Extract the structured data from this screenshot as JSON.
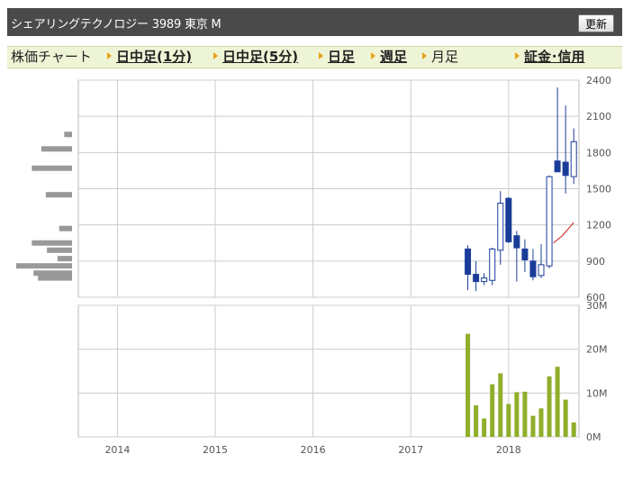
{
  "header": {
    "title": "シェアリングテクノロジー 3989 東京 M",
    "refresh_label": "更新"
  },
  "tabs": [
    {
      "label": "株価チャート",
      "link": false,
      "arrow": false
    },
    {
      "label": "日中足(1分)",
      "link": true,
      "arrow": true
    },
    {
      "label": "日中足(5分)",
      "link": true,
      "arrow": true
    },
    {
      "label": "日足",
      "link": true,
      "arrow": true
    },
    {
      "label": "週足",
      "link": true,
      "arrow": true
    },
    {
      "label": "月足",
      "link": false,
      "arrow": true
    },
    {
      "label": "証金･信用",
      "link": true,
      "arrow": true
    }
  ],
  "colors": {
    "up_candle": "#ffffff",
    "down_candle": "#1a3c99",
    "volume_bar": "#8fae2a",
    "moving_average": "#d01919",
    "volume_profile": "#999999",
    "grid": "#cccccc",
    "header_bg": "#4a4a4a",
    "tab_bg": "#eef5d6",
    "tab_arrow": "#e8a11a"
  },
  "chart_data": [
    {
      "type": "candlestick",
      "name": "price",
      "y_ticks": [
        "2400",
        "2100",
        "1800",
        "1500",
        "1200",
        "900",
        "600"
      ],
      "ylim": [
        600,
        2400
      ],
      "x_ticks": [
        "2014",
        "2015",
        "2016",
        "2017",
        "2018"
      ],
      "x_tick_positions": [
        2014,
        2015,
        2016,
        2017,
        2018
      ],
      "xlim": [
        2013.6,
        2018.72
      ],
      "grid": true,
      "candles": [
        {
          "t": 2017.5833,
          "open": 1000,
          "high": 1030,
          "low": 660,
          "close": 790
        },
        {
          "t": 2017.6667,
          "open": 790,
          "high": 900,
          "low": 650,
          "close": 730
        },
        {
          "t": 2017.75,
          "open": 730,
          "high": 800,
          "low": 700,
          "close": 760
        },
        {
          "t": 2017.8333,
          "open": 740,
          "high": 1010,
          "low": 700,
          "close": 1000
        },
        {
          "t": 2017.9167,
          "open": 990,
          "high": 1480,
          "low": 870,
          "close": 1380
        },
        {
          "t": 2018.0,
          "open": 1420,
          "high": 1430,
          "low": 1050,
          "close": 1060
        },
        {
          "t": 2018.0833,
          "open": 1110,
          "high": 1150,
          "low": 730,
          "close": 1010
        },
        {
          "t": 2018.1667,
          "open": 1000,
          "high": 1080,
          "low": 810,
          "close": 910
        },
        {
          "t": 2018.25,
          "open": 900,
          "high": 1000,
          "low": 740,
          "close": 770
        },
        {
          "t": 2018.3333,
          "open": 780,
          "high": 1040,
          "low": 760,
          "close": 870
        },
        {
          "t": 2018.4167,
          "open": 860,
          "high": 1610,
          "low": 840,
          "close": 1600
        },
        {
          "t": 2018.5,
          "open": 1730,
          "high": 2340,
          "low": 1640,
          "close": 1640
        },
        {
          "t": 2018.5833,
          "open": 1720,
          "high": 2190,
          "low": 1460,
          "close": 1610
        },
        {
          "t": 2018.6667,
          "open": 1600,
          "high": 2000,
          "low": 1540,
          "close": 1890
        }
      ],
      "moving_average": [
        {
          "t": 2018.4583,
          "v": 1050
        },
        {
          "t": 2018.55,
          "v": 1110
        },
        {
          "t": 2018.6667,
          "v": 1220
        }
      ],
      "volume_profile": [
        {
          "price": 1950,
          "weight": 0.14
        },
        {
          "price": 1830,
          "weight": 0.55
        },
        {
          "price": 1670,
          "weight": 0.72
        },
        {
          "price": 1450,
          "weight": 0.47
        },
        {
          "price": 1170,
          "weight": 0.23
        },
        {
          "price": 1050,
          "weight": 0.72
        },
        {
          "price": 990,
          "weight": 0.45
        },
        {
          "price": 920,
          "weight": 0.26
        },
        {
          "price": 860,
          "weight": 1.0
        },
        {
          "price": 800,
          "weight": 0.69
        },
        {
          "price": 760,
          "weight": 0.61
        }
      ]
    },
    {
      "type": "bar",
      "name": "volume",
      "y_ticks": [
        "30M",
        "20M",
        "10M",
        "0M"
      ],
      "ylim": [
        0,
        30
      ],
      "unit": "M",
      "grid": true,
      "bars": [
        {
          "t": 2017.5833,
          "v": 23.5
        },
        {
          "t": 2017.6667,
          "v": 7.2
        },
        {
          "t": 2017.75,
          "v": 4.2
        },
        {
          "t": 2017.8333,
          "v": 12.0
        },
        {
          "t": 2017.9167,
          "v": 14.5
        },
        {
          "t": 2018.0,
          "v": 7.5
        },
        {
          "t": 2018.0833,
          "v": 10.2
        },
        {
          "t": 2018.1667,
          "v": 10.3
        },
        {
          "t": 2018.25,
          "v": 4.8
        },
        {
          "t": 2018.3333,
          "v": 6.5
        },
        {
          "t": 2018.4167,
          "v": 13.8
        },
        {
          "t": 2018.5,
          "v": 16.0
        },
        {
          "t": 2018.5833,
          "v": 8.5
        },
        {
          "t": 2018.6667,
          "v": 3.3
        }
      ]
    }
  ]
}
